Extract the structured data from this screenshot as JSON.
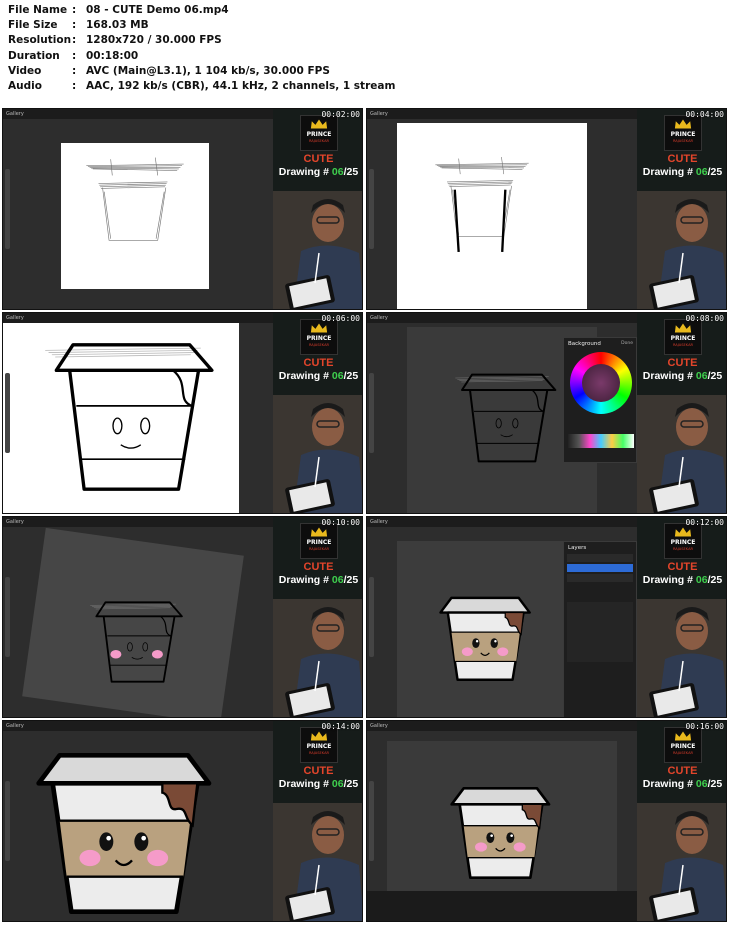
{
  "meta": {
    "rows": [
      {
        "key": "File Name",
        "sep": ":",
        "value": "08 - CUTE Demo 06.mp4"
      },
      {
        "key": "File Size",
        "sep": ":",
        "value": "168.03 MB"
      },
      {
        "key": "Resolution",
        "sep": ":",
        "value": "1280x720 / 30.000 FPS"
      },
      {
        "key": "Duration",
        "sep": ":",
        "value": "00:18:00"
      },
      {
        "key": "Video",
        "sep": ":",
        "value": "AVC (Main@L3.1), 1 104 kb/s, 30.000 FPS"
      },
      {
        "key": "Audio",
        "sep": ":",
        "value": "AAC, 192 kb/s (CBR), 44.1 kHz, 2 channels, 1 stream"
      }
    ]
  },
  "overlay": {
    "brand_main": "PRINCE",
    "brand_sub": "RAJASEKAR",
    "cute": "CUTE",
    "drawing_prefix": "Drawing # ",
    "drawing_num": "06",
    "drawing_suffix": "/25",
    "app_label": "Gallery"
  },
  "thumbs": [
    {
      "timestamp": "00:02:00"
    },
    {
      "timestamp": "00:04:00"
    },
    {
      "timestamp": "00:06:00"
    },
    {
      "timestamp": "00:08:00",
      "panel_title": "Background",
      "panel_action": "Done"
    },
    {
      "timestamp": "00:10:00"
    },
    {
      "timestamp": "00:12:00",
      "panel_title": "Layers"
    },
    {
      "timestamp": "00:14:00"
    },
    {
      "timestamp": "00:16:00"
    }
  ],
  "colors": {
    "cup_tan": "#b9a17f",
    "lid_gray": "#d9d9d9",
    "blush": "#f59bc9",
    "choc": "#7a4a36",
    "accent_red": "#e3452b",
    "accent_green": "#3fcf4e",
    "crown": "#e9b91d"
  }
}
